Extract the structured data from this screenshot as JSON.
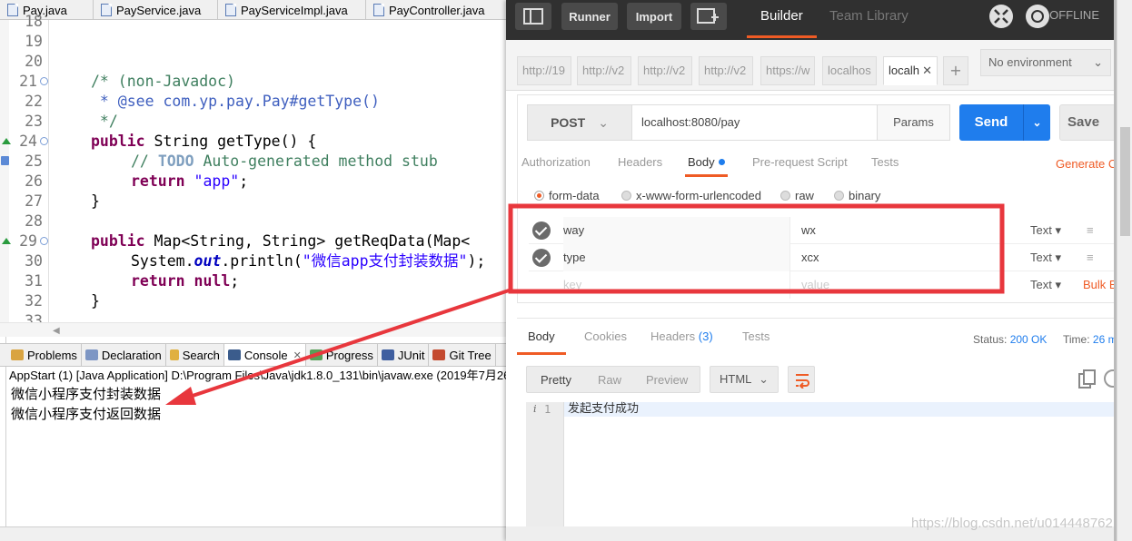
{
  "eclipse": {
    "editor_tabs": [
      "Pay.java",
      "PayService.java",
      "PayServiceImpl.java",
      "PayController.java"
    ],
    "line_numbers": [
      "18",
      "19",
      "20",
      "21",
      "22",
      "23",
      "24",
      "25",
      "26",
      "27",
      "28",
      "29",
      "30",
      "31",
      "32",
      "33"
    ],
    "code": {
      "l21_comment": "/* (non-Javadoc)",
      "l22_see_tag": " * @see ",
      "l22_ref": "com.yp.pay.Pay#getType()",
      "l23_end": " */",
      "l24_kw": "public",
      "l24_rest": " String getType() {",
      "l25_prefix": "// ",
      "l25_todo": "TODO",
      "l25_rest": " Auto-generated method stub",
      "l26_kw": "return",
      "l26_str": "\"app\"",
      "l26_end": ";",
      "l27": "}",
      "l29_kw": "public",
      "l29_rest": " Map<String, String> getReqData(Map<",
      "l30_prefix": "System.",
      "l30_field": "out",
      "l30_mid": ".println(",
      "l30_str": "\"微信app支付封装数据\"",
      "l30_end": ");",
      "l31_kw1": "return",
      "l31_kw2": "null",
      "l31_end": ";",
      "l32": "}"
    },
    "view_tabs": [
      "Problems",
      "Declaration",
      "Search",
      "Console",
      "Progress",
      "JUnit",
      "Git Tree"
    ],
    "console": {
      "header": "AppStart (1) [Java Application] D:\\Program Files\\Java\\jdk1.8.0_131\\bin\\javaw.exe (2019年7月26",
      "lines": [
        "微信小程序支付封装数据",
        "微信小程序支付返回数据"
      ]
    }
  },
  "postman": {
    "header": {
      "runner": "Runner",
      "import": "Import",
      "builder": "Builder",
      "team_library": "Team Library",
      "status": "OFFLINE"
    },
    "request_tabs": [
      "http://19",
      "http://v2",
      "http://v2",
      "http://v2",
      "https://w",
      "localhos",
      "localh"
    ],
    "environment": "No environment",
    "request": {
      "method": "POST",
      "url": "localhost:8080/pay",
      "params_label": "Params",
      "send_label": "Send",
      "save_label": "Save"
    },
    "request_subtabs": [
      "Authorization",
      "Headers",
      "Body",
      "Pre-request Script",
      "Tests"
    ],
    "generate_code": "Generate Co",
    "body_modes": [
      "form-data",
      "x-www-form-urlencoded",
      "raw",
      "binary"
    ],
    "form_rows": [
      {
        "key": "way",
        "value": "wx",
        "type": "Text ▾"
      },
      {
        "key": "type",
        "value": "xcx",
        "type": "Text ▾"
      }
    ],
    "new_row": {
      "key_placeholder": "key",
      "value_placeholder": "value",
      "type": "Text ▾"
    },
    "bulk_edit": "Bulk E",
    "response_tabs": {
      "body": "Body",
      "cookies": "Cookies",
      "headers": "Headers",
      "headers_count": "(3)",
      "tests": "Tests"
    },
    "status_label": "Status:",
    "status_value": "200 OK",
    "time_label": "Time:",
    "time_value": "26 m",
    "format_tabs": [
      "Pretty",
      "Raw",
      "Preview"
    ],
    "language": "HTML",
    "response_line_number": "1",
    "response_text": "发起支付成功"
  },
  "watermark": "https://blog.csdn.net/u014448762",
  "colors": {
    "accent_orange": "#ef5b25",
    "send_blue": "#1f7ded",
    "annotation_red": "#e8373d"
  }
}
